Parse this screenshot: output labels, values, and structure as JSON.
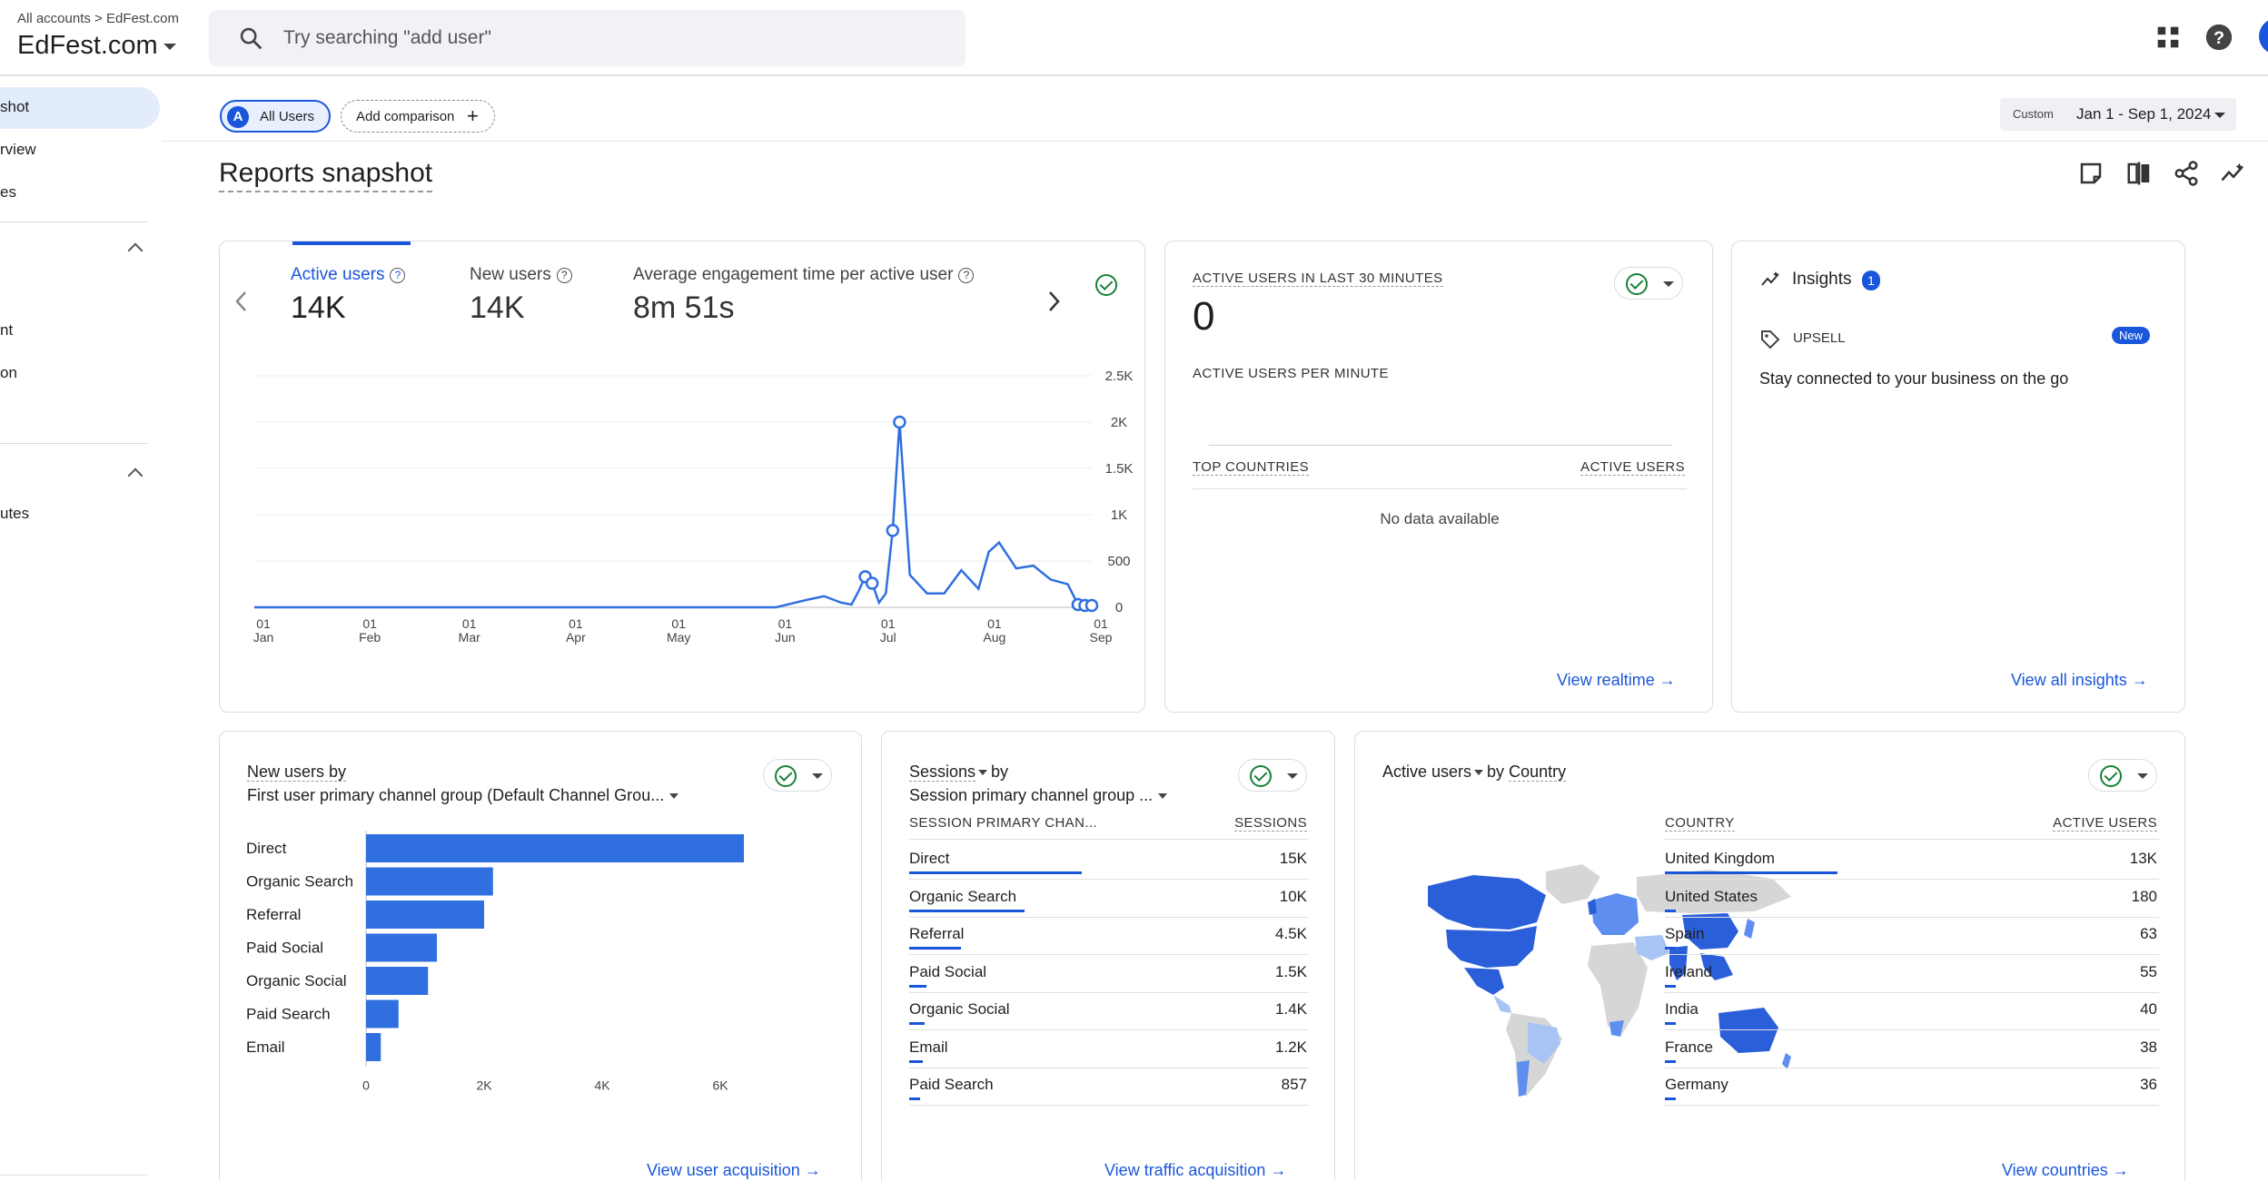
{
  "header": {
    "breadcrumb_root": "All accounts",
    "breadcrumb_leaf": "EdFest.com",
    "account_name": "EdFest.com",
    "search_placeholder": "Try searching \"add user\""
  },
  "sidebar": {
    "items": [
      {
        "label": "shot",
        "active": true
      },
      {
        "label": "rview"
      },
      {
        "label": "es"
      },
      {
        "label": "nt"
      },
      {
        "label": "on"
      },
      {
        "label": "utes"
      }
    ]
  },
  "filters": {
    "segment_badge": "A",
    "segment_label": "All Users",
    "add_comparison": "Add comparison",
    "date_custom": "Custom",
    "date_range": "Jan 1 - Sep 1, 2024"
  },
  "page": {
    "title": "Reports snapshot"
  },
  "overview": {
    "metrics": [
      {
        "label": "Active users",
        "value": "14K",
        "selected": true
      },
      {
        "label": "New users",
        "value": "14K"
      },
      {
        "label": "Average engagement time per active user",
        "value": "8m 51s"
      }
    ],
    "y_ticks": [
      "2.5K",
      "2K",
      "1.5K",
      "1K",
      "500",
      "0"
    ],
    "x_ticks": [
      {
        "day": "01",
        "month": "Jan"
      },
      {
        "day": "01",
        "month": "Feb"
      },
      {
        "day": "01",
        "month": "Mar"
      },
      {
        "day": "01",
        "month": "Apr"
      },
      {
        "day": "01",
        "month": "May"
      },
      {
        "day": "01",
        "month": "Jun"
      },
      {
        "day": "01",
        "month": "Jul"
      },
      {
        "day": "01",
        "month": "Aug"
      },
      {
        "day": "01",
        "month": "Sep"
      }
    ]
  },
  "chart_data": [
    {
      "type": "line",
      "title": "Active users",
      "x_unit": "date (2024)",
      "ylim": [
        0,
        2500
      ],
      "grid": true,
      "x": [
        "2024-01-01",
        "2024-02-01",
        "2024-03-01",
        "2024-04-01",
        "2024-05-01",
        "2024-06-01",
        "2024-06-10",
        "2024-06-15",
        "2024-06-20",
        "2024-06-23",
        "2024-06-25",
        "2024-06-27",
        "2024-06-29",
        "2024-07-01",
        "2024-07-03",
        "2024-07-05",
        "2024-07-07",
        "2024-07-10",
        "2024-07-15",
        "2024-07-20",
        "2024-07-25",
        "2024-07-30",
        "2024-08-02",
        "2024-08-05",
        "2024-08-10",
        "2024-08-15",
        "2024-08-20",
        "2024-08-25",
        "2024-08-28",
        "2024-08-30",
        "2024-09-01"
      ],
      "series": [
        {
          "name": "Active users",
          "values": [
            0,
            0,
            0,
            0,
            0,
            0,
            80,
            120,
            50,
            30,
            170,
            330,
            260,
            50,
            150,
            830,
            2000,
            350,
            150,
            150,
            400,
            200,
            600,
            700,
            420,
            450,
            300,
            250,
            30,
            20,
            20
          ]
        }
      ]
    },
    {
      "type": "bar",
      "title": "New users by First user primary channel group (Default Channel Group)",
      "orientation": "horizontal",
      "categories": [
        "Direct",
        "Organic Search",
        "Referral",
        "Paid Social",
        "Organic Social",
        "Paid Search",
        "Email"
      ],
      "values": [
        6400,
        2150,
        2000,
        1200,
        1050,
        550,
        250
      ],
      "xlim": [
        0,
        7000
      ],
      "x_ticks": [
        "0",
        "2K",
        "4K",
        "6K"
      ]
    }
  ],
  "realtime": {
    "title": "ACTIVE USERS IN LAST 30 MINUTES",
    "value": "0",
    "per_minute": "ACTIVE USERS PER MINUTE",
    "col_country": "TOP COUNTRIES",
    "col_users": "ACTIVE USERS",
    "empty": "No data available",
    "link": "View realtime"
  },
  "insights": {
    "title": "Insights",
    "count": "1",
    "tag": "UPSELL",
    "new_badge": "New",
    "text": "Stay connected to your business on the go",
    "link": "View all insights"
  },
  "acquisition": {
    "title_line1": "New users by",
    "title_line2": "First user primary channel group (Default Channel Grou...",
    "link": "View user acquisition"
  },
  "sessions": {
    "title_metric": "Sessions",
    "title_by": "by",
    "title_line2": "Session primary channel group ...",
    "col_channel": "SESSION PRIMARY CHAN...",
    "col_sessions": "SESSIONS",
    "rows": [
      {
        "label": "Direct",
        "value": "15K",
        "share": 1.0
      },
      {
        "label": "Organic Search",
        "value": "10K",
        "share": 0.67
      },
      {
        "label": "Referral",
        "value": "4.5K",
        "share": 0.3
      },
      {
        "label": "Paid Social",
        "value": "1.5K",
        "share": 0.1
      },
      {
        "label": "Organic Social",
        "value": "1.4K",
        "share": 0.09
      },
      {
        "label": "Email",
        "value": "1.2K",
        "share": 0.08
      },
      {
        "label": "Paid Search",
        "value": "857",
        "share": 0.06
      }
    ],
    "link": "View traffic acquisition"
  },
  "countries": {
    "title_metric": "Active users",
    "title_by": "by",
    "title_dim": "Country",
    "col_country": "COUNTRY",
    "col_users": "ACTIVE USERS",
    "rows": [
      {
        "label": "United Kingdom",
        "value": "13K",
        "share": 1.0
      },
      {
        "label": "United States",
        "value": "180",
        "share": 0.02
      },
      {
        "label": "Spain",
        "value": "63",
        "share": 0.01
      },
      {
        "label": "Ireland",
        "value": "55",
        "share": 0.01
      },
      {
        "label": "India",
        "value": "40",
        "share": 0.01
      },
      {
        "label": "France",
        "value": "38",
        "share": 0.01
      },
      {
        "label": "Germany",
        "value": "36",
        "share": 0.01
      }
    ],
    "link": "View countries"
  },
  "colors": {
    "accent": "#1a56db",
    "line": "#2f6fe0",
    "map_dark": "#2b5fd9",
    "map_mid": "#5d8ef0",
    "map_light": "#a8c4f5",
    "map_none": "#d6d6d6"
  }
}
